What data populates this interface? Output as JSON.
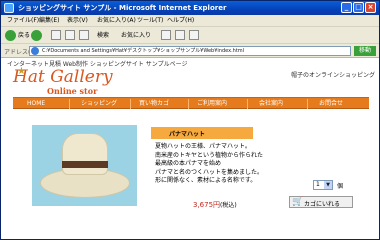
{
  "window": {
    "title": "ショッピングサイト サンプル - Microsoft Internet Explorer",
    "controls": {
      "minimize": "_",
      "maximize": "□",
      "close": "×"
    }
  },
  "menu": [
    "ファイル(F)",
    "編集(E)",
    "表示(V)",
    "お気に入り(A)",
    "ツール(T)",
    "ヘルプ(H)"
  ],
  "toolbar": {
    "back_label": "戻る",
    "search_label": "検索",
    "favorites_label": "お気に入り"
  },
  "address": {
    "label": "アドレス(D)",
    "url": "C:¥Documents and Settings¥Hat¥デスクトップ¥ショップサンプル¥Web¥index.html",
    "go_label": "移動"
  },
  "page": {
    "breadcrumb": "インターネット見積 Web制作 ショッピングサイト サンプルページ",
    "logo_title": "Hat Gallery",
    "logo_subtitle": "Online stor",
    "tagline": "帽子のオンラインショッピング",
    "nav": [
      "HOME",
      "ショッピング",
      "買い物カゴ",
      "ご利用案内",
      "会社案内",
      "お問合せ"
    ],
    "product": {
      "name": "パナマハット",
      "description": [
        "夏物ハットの王様、パナマハット。",
        "南米産のトキヤという植物から作られた",
        "最高級の本パナマを始め",
        "パナマと名のつくハットを集めました。",
        "形に関係なく、素材による名称です。"
      ],
      "quantity": "1",
      "quantity_unit": "個",
      "price": "3,675円",
      "price_note": "(税込)",
      "cart_label": "カゴにいれる"
    }
  }
}
